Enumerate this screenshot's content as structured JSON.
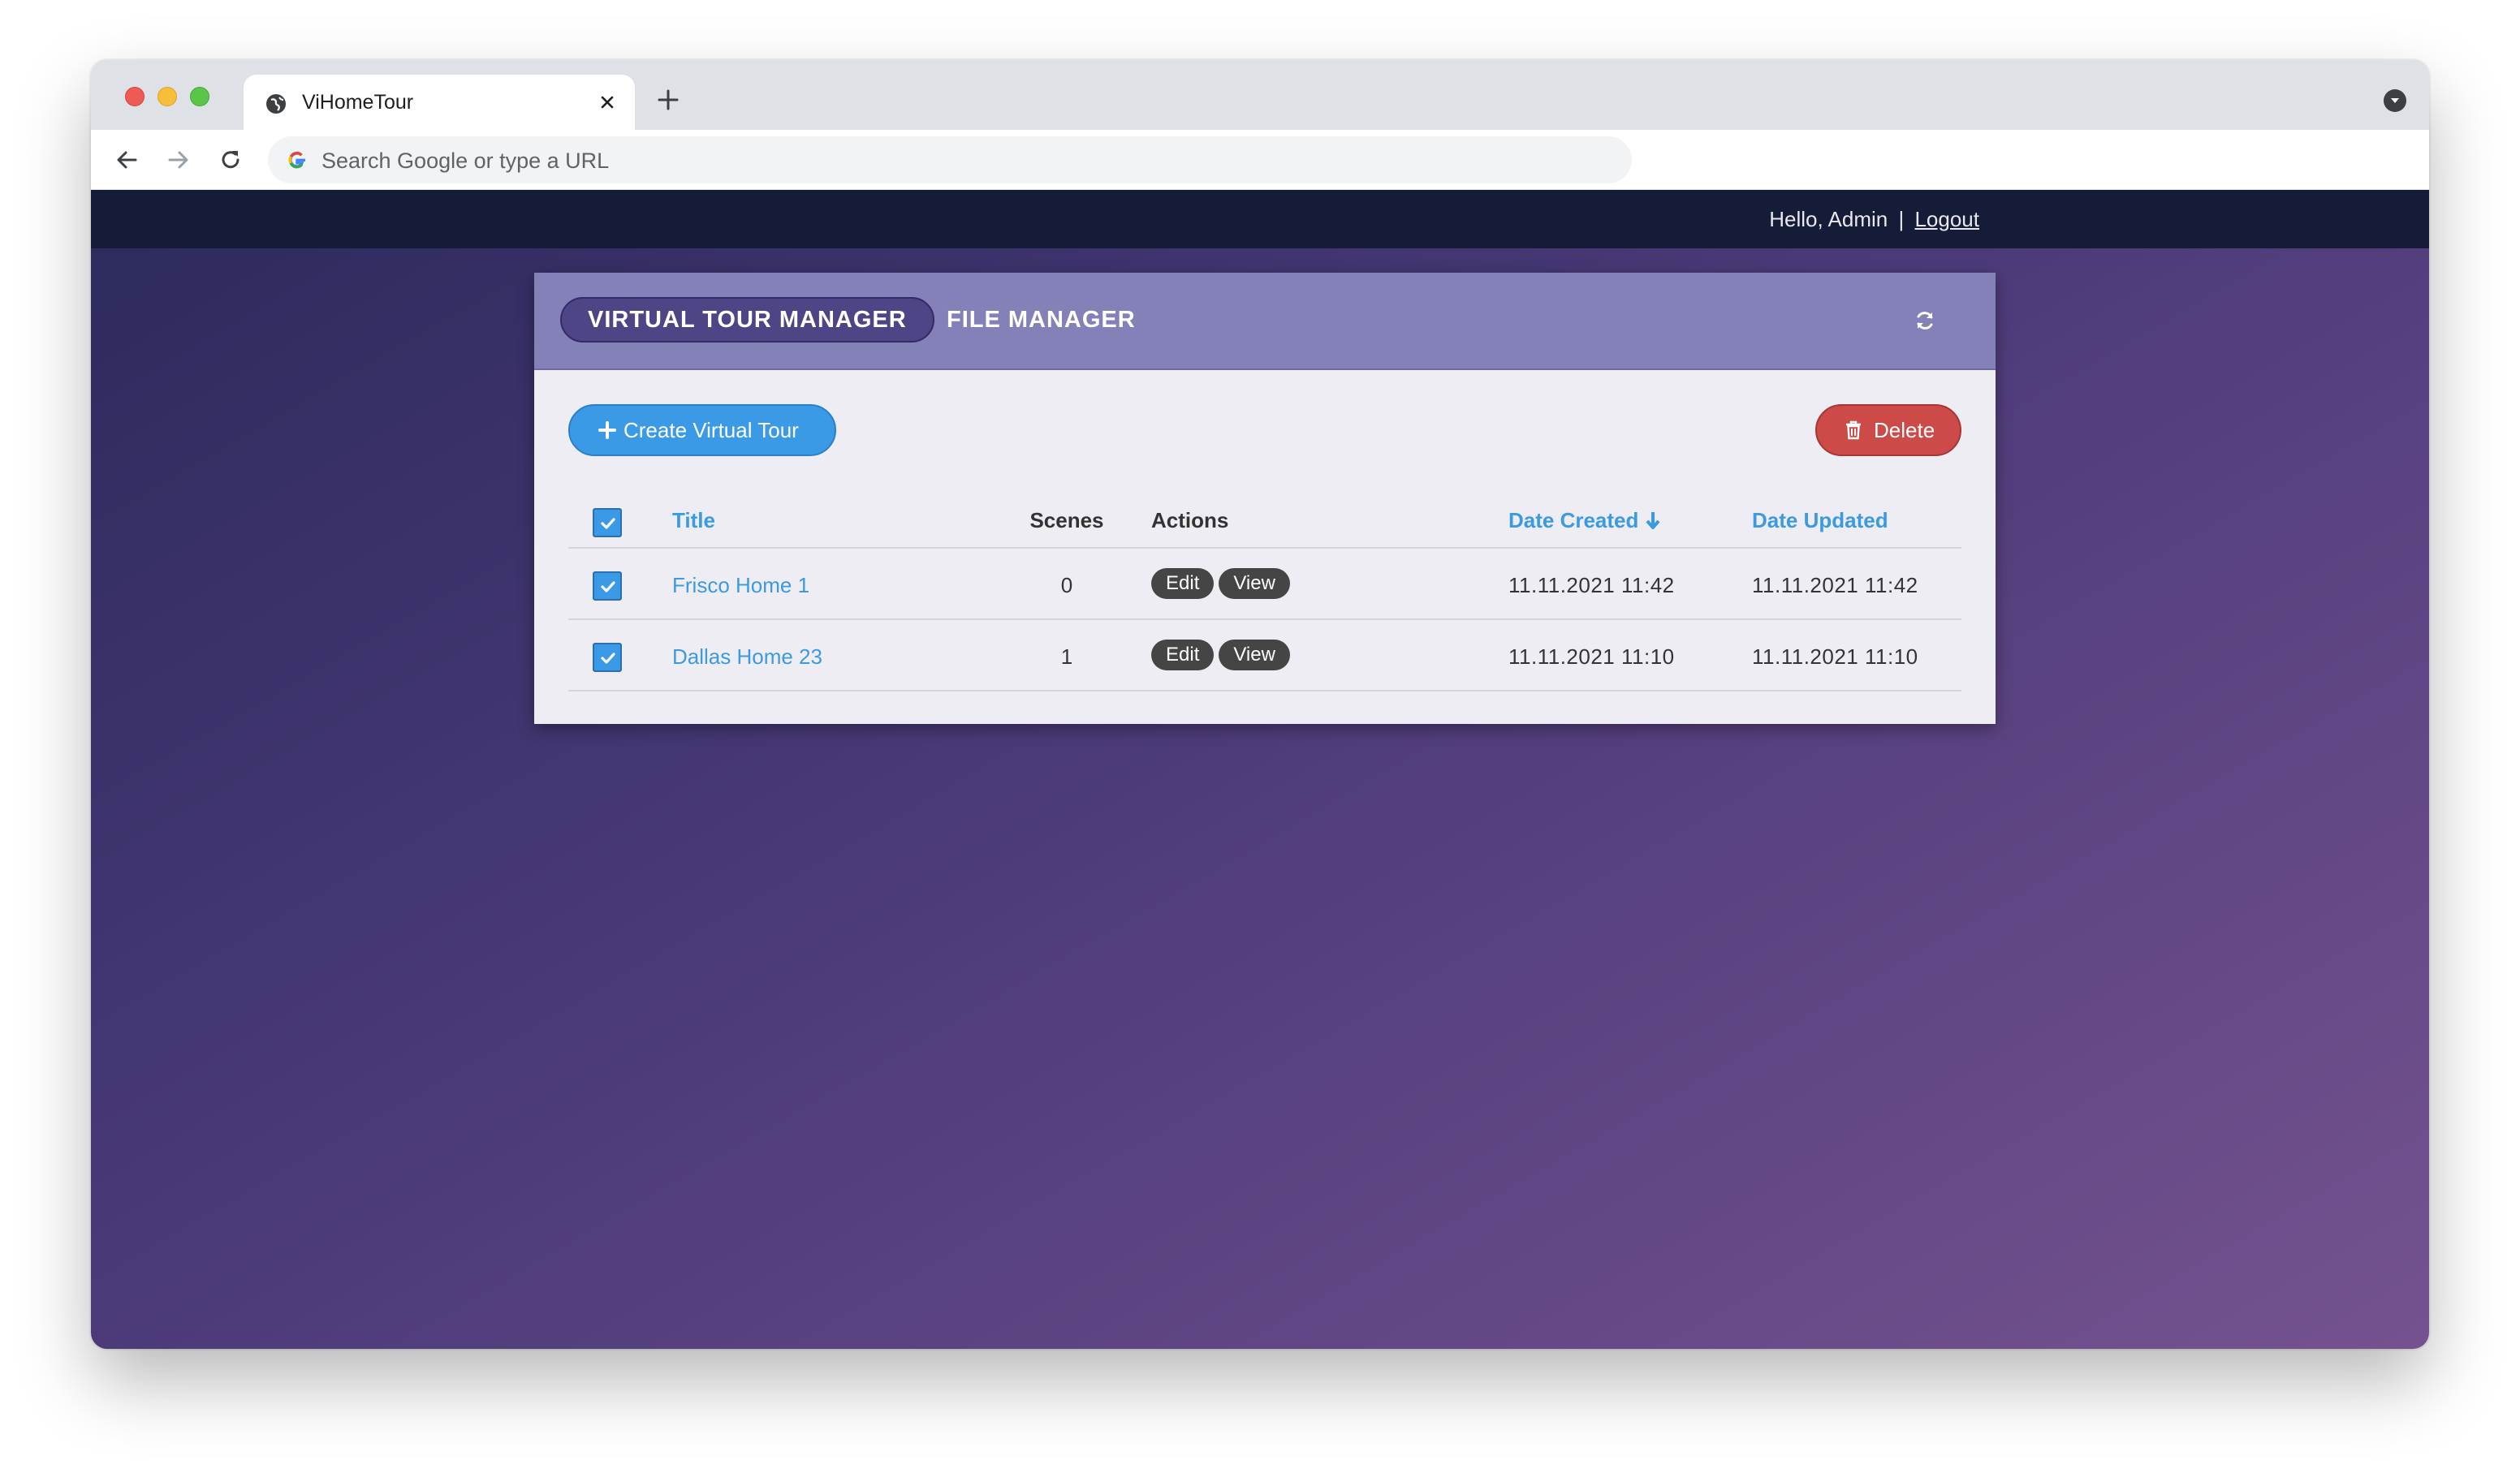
{
  "browser": {
    "tab_title": "ViHomeTour",
    "omnibox_placeholder": "Search Google or type a URL"
  },
  "topbar": {
    "greeting": "Hello, Admin",
    "separator": "|",
    "logout_label": "Logout"
  },
  "panel": {
    "tabs": [
      {
        "label": "VIRTUAL TOUR MANAGER",
        "active": true
      },
      {
        "label": "FILE MANAGER",
        "active": false
      }
    ],
    "create_button_label": "Create Virtual Tour",
    "delete_button_label": "Delete"
  },
  "table": {
    "columns": {
      "title": "Title",
      "scenes": "Scenes",
      "actions": "Actions",
      "date_created": "Date Created",
      "date_updated": "Date Updated"
    },
    "rows": [
      {
        "title": "Frisco Home 1",
        "scenes": "0",
        "edit": "Edit",
        "view": "View",
        "date_created": "11.11.2021 11:42",
        "date_updated": "11.11.2021 11:42",
        "checked": true
      },
      {
        "title": "Dallas Home 23",
        "scenes": "1",
        "edit": "Edit",
        "view": "View",
        "date_created": "11.11.2021 11:10",
        "date_updated": "11.11.2021 11:10",
        "checked": true
      }
    ]
  },
  "colors": {
    "accent_blue": "#3b9ae6",
    "danger_red": "#cc4a48",
    "panel_header": "#8480b8",
    "topnav": "#141c38"
  },
  "icons": [
    "globe-icon",
    "close-icon",
    "plus-icon",
    "back-icon",
    "forward-icon",
    "reload-icon",
    "google-icon",
    "refresh-icon",
    "trash-icon",
    "check-icon",
    "arrow-down-icon"
  ]
}
